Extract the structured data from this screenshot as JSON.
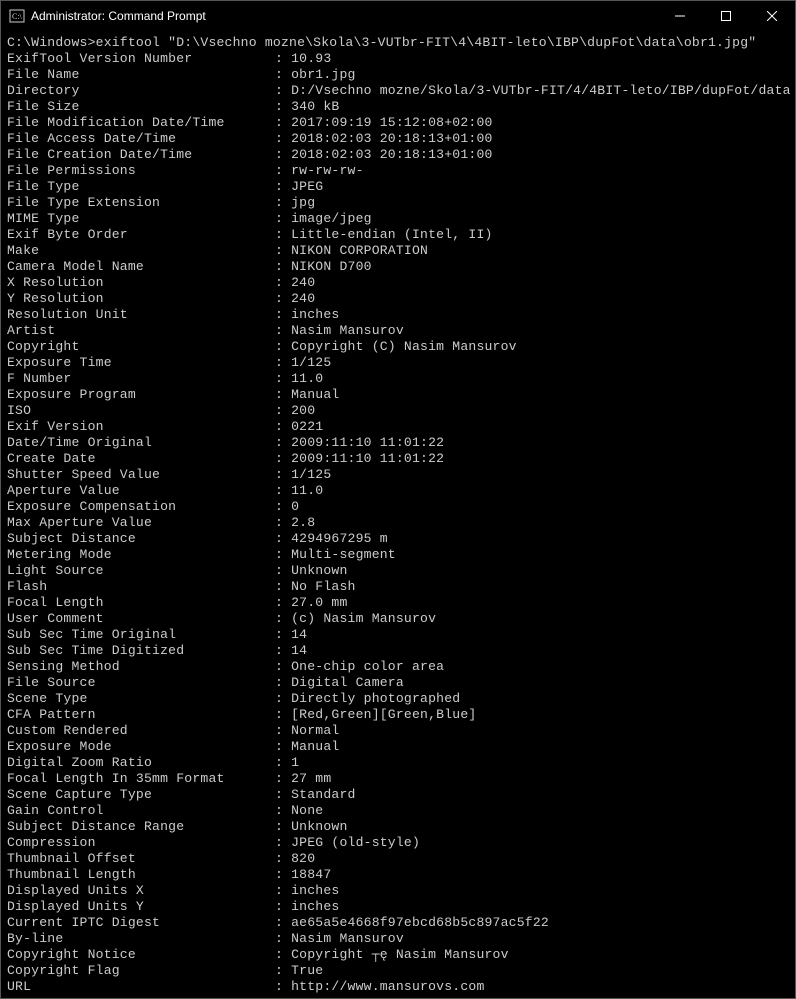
{
  "titlebar": {
    "title": "Administrator: Command Prompt"
  },
  "prompt": "C:\\Windows>exiftool \"D:\\Vsechno mozne\\Skola\\3-VUTbr-FIT\\4\\4BIT-leto\\IBP\\dupFot\\data\\obr1.jpg\"",
  "rows": [
    {
      "k": "ExifTool Version Number",
      "v": "10.93"
    },
    {
      "k": "File Name",
      "v": "obr1.jpg"
    },
    {
      "k": "Directory",
      "v": "D:/Vsechno mozne/Skola/3-VUTbr-FIT/4/4BIT-leto/IBP/dupFot/data"
    },
    {
      "k": "File Size",
      "v": "340 kB"
    },
    {
      "k": "File Modification Date/Time",
      "v": "2017:09:19 15:12:08+02:00"
    },
    {
      "k": "File Access Date/Time",
      "v": "2018:02:03 20:18:13+01:00"
    },
    {
      "k": "File Creation Date/Time",
      "v": "2018:02:03 20:18:13+01:00"
    },
    {
      "k": "File Permissions",
      "v": "rw-rw-rw-"
    },
    {
      "k": "File Type",
      "v": "JPEG"
    },
    {
      "k": "File Type Extension",
      "v": "jpg"
    },
    {
      "k": "MIME Type",
      "v": "image/jpeg"
    },
    {
      "k": "Exif Byte Order",
      "v": "Little-endian (Intel, II)"
    },
    {
      "k": "Make",
      "v": "NIKON CORPORATION"
    },
    {
      "k": "Camera Model Name",
      "v": "NIKON D700"
    },
    {
      "k": "X Resolution",
      "v": "240"
    },
    {
      "k": "Y Resolution",
      "v": "240"
    },
    {
      "k": "Resolution Unit",
      "v": "inches"
    },
    {
      "k": "Artist",
      "v": "Nasim Mansurov"
    },
    {
      "k": "Copyright",
      "v": "Copyright (C) Nasim Mansurov"
    },
    {
      "k": "Exposure Time",
      "v": "1/125"
    },
    {
      "k": "F Number",
      "v": "11.0"
    },
    {
      "k": "Exposure Program",
      "v": "Manual"
    },
    {
      "k": "ISO",
      "v": "200"
    },
    {
      "k": "Exif Version",
      "v": "0221"
    },
    {
      "k": "Date/Time Original",
      "v": "2009:11:10 11:01:22"
    },
    {
      "k": "Create Date",
      "v": "2009:11:10 11:01:22"
    },
    {
      "k": "Shutter Speed Value",
      "v": "1/125"
    },
    {
      "k": "Aperture Value",
      "v": "11.0"
    },
    {
      "k": "Exposure Compensation",
      "v": "0"
    },
    {
      "k": "Max Aperture Value",
      "v": "2.8"
    },
    {
      "k": "Subject Distance",
      "v": "4294967295 m"
    },
    {
      "k": "Metering Mode",
      "v": "Multi-segment"
    },
    {
      "k": "Light Source",
      "v": "Unknown"
    },
    {
      "k": "Flash",
      "v": "No Flash"
    },
    {
      "k": "Focal Length",
      "v": "27.0 mm"
    },
    {
      "k": "User Comment",
      "v": "(c) Nasim Mansurov"
    },
    {
      "k": "Sub Sec Time Original",
      "v": "14"
    },
    {
      "k": "Sub Sec Time Digitized",
      "v": "14"
    },
    {
      "k": "Sensing Method",
      "v": "One-chip color area"
    },
    {
      "k": "File Source",
      "v": "Digital Camera"
    },
    {
      "k": "Scene Type",
      "v": "Directly photographed"
    },
    {
      "k": "CFA Pattern",
      "v": "[Red,Green][Green,Blue]"
    },
    {
      "k": "Custom Rendered",
      "v": "Normal"
    },
    {
      "k": "Exposure Mode",
      "v": "Manual"
    },
    {
      "k": "Digital Zoom Ratio",
      "v": "1"
    },
    {
      "k": "Focal Length In 35mm Format",
      "v": "27 mm"
    },
    {
      "k": "Scene Capture Type",
      "v": "Standard"
    },
    {
      "k": "Gain Control",
      "v": "None"
    },
    {
      "k": "Subject Distance Range",
      "v": "Unknown"
    },
    {
      "k": "Compression",
      "v": "JPEG (old-style)"
    },
    {
      "k": "Thumbnail Offset",
      "v": "820"
    },
    {
      "k": "Thumbnail Length",
      "v": "18847"
    },
    {
      "k": "Displayed Units X",
      "v": "inches"
    },
    {
      "k": "Displayed Units Y",
      "v": "inches"
    },
    {
      "k": "Current IPTC Digest",
      "v": "ae65a5e4668f97ebcd68b5c897ac5f22"
    },
    {
      "k": "By-line",
      "v": "Nasim Mansurov"
    },
    {
      "k": "Copyright Notice",
      "v": "Copyright ┬ę Nasim Mansurov"
    },
    {
      "k": "Copyright Flag",
      "v": "True"
    },
    {
      "k": "URL",
      "v": "http://www.mansurovs.com"
    }
  ]
}
